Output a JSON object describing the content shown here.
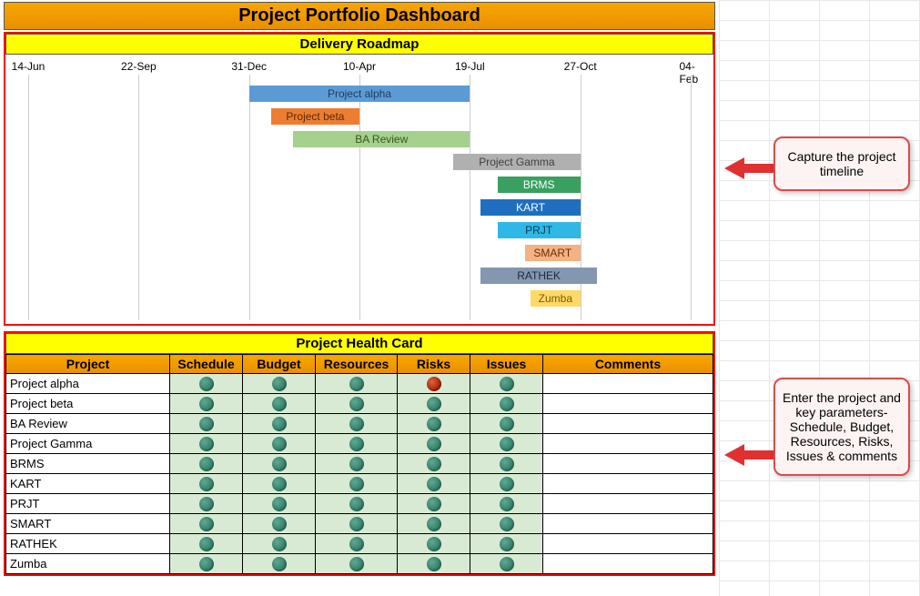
{
  "title": "Project Portfolio Dashboard",
  "roadmap_title": "Delivery Roadmap",
  "health_title": "Project Health Card",
  "dates": [
    "14-Jun",
    "22-Sep",
    "31-Dec",
    "10-Apr",
    "19-Jul",
    "27-Oct",
    "04-Feb"
  ],
  "bars": [
    {
      "label": "Project alpha",
      "color": "#5b9bd5",
      "fg": "#1f3a5f"
    },
    {
      "label": "Project beta",
      "color": "#ed7d31",
      "fg": "#5a2a00"
    },
    {
      "label": "BA Review",
      "color": "#a5d08e",
      "fg": "#385723"
    },
    {
      "label": "Project Gamma",
      "color": "#b0b0b0",
      "fg": "#404040"
    },
    {
      "label": "BRMS",
      "color": "#3aa060",
      "fg": "#fff"
    },
    {
      "label": "KART",
      "color": "#1f6fc0",
      "fg": "#fff"
    },
    {
      "label": "PRJT",
      "color": "#2fb8e5",
      "fg": "#0a3c50"
    },
    {
      "label": "SMART",
      "color": "#f4b183",
      "fg": "#6a3000"
    },
    {
      "label": "RATHEK",
      "color": "#8497b0",
      "fg": "#1e2a3a"
    },
    {
      "label": "Zumba",
      "color": "#ffd966",
      "fg": "#7a5a00"
    }
  ],
  "health_columns": [
    "Project",
    "Schedule",
    "Budget",
    "Resources",
    "Risks",
    "Issues",
    "Comments"
  ],
  "health_rows": [
    {
      "project": "Project alpha",
      "status": [
        "g",
        "g",
        "g",
        "r",
        "g"
      ],
      "comments": ""
    },
    {
      "project": "Project beta",
      "status": [
        "g",
        "g",
        "g",
        "g",
        "g"
      ],
      "comments": ""
    },
    {
      "project": "BA Review",
      "status": [
        "g",
        "g",
        "g",
        "g",
        "g"
      ],
      "comments": ""
    },
    {
      "project": "Project Gamma",
      "status": [
        "g",
        "g",
        "g",
        "g",
        "g"
      ],
      "comments": ""
    },
    {
      "project": "BRMS",
      "status": [
        "g",
        "g",
        "g",
        "g",
        "g"
      ],
      "comments": ""
    },
    {
      "project": "KART",
      "status": [
        "g",
        "g",
        "g",
        "g",
        "g"
      ],
      "comments": ""
    },
    {
      "project": "PRJT",
      "status": [
        "g",
        "g",
        "g",
        "g",
        "g"
      ],
      "comments": ""
    },
    {
      "project": "SMART",
      "status": [
        "g",
        "g",
        "g",
        "g",
        "g"
      ],
      "comments": ""
    },
    {
      "project": "RATHEK",
      "status": [
        "g",
        "g",
        "g",
        "g",
        "g"
      ],
      "comments": ""
    },
    {
      "project": "Zumba",
      "status": [
        "g",
        "g",
        "g",
        "g",
        "g"
      ],
      "comments": ""
    }
  ],
  "callout1": "Capture the project timeline",
  "callout2": "Enter the project and key parameters- Schedule, Budget, Resources, Risks, Issues & comments",
  "chart_data": {
    "type": "bar",
    "orientation": "horizontal-gantt",
    "title": "Delivery Roadmap",
    "x_ticks": [
      "14-Jun",
      "22-Sep",
      "31-Dec",
      "10-Apr",
      "19-Jul",
      "27-Oct",
      "04-Feb"
    ],
    "xlabel": "",
    "ylabel": "",
    "series": [
      {
        "name": "Project alpha",
        "start": "31-Dec",
        "end": "19-Jul"
      },
      {
        "name": "Project beta",
        "start": "20-Jan",
        "end": "20-Mar"
      },
      {
        "name": "BA Review",
        "start": "15-Feb",
        "end": "19-Jul"
      },
      {
        "name": "Project Gamma",
        "start": "05-Jul",
        "end": "27-Oct"
      },
      {
        "name": "BRMS",
        "start": "10-Aug",
        "end": "27-Oct"
      },
      {
        "name": "KART",
        "start": "05-Aug",
        "end": "27-Oct"
      },
      {
        "name": "PRJT",
        "start": "10-Aug",
        "end": "27-Oct"
      },
      {
        "name": "SMART",
        "start": "02-Sep",
        "end": "27-Oct"
      },
      {
        "name": "RATHEK",
        "start": "05-Aug",
        "end": "10-Nov"
      },
      {
        "name": "Zumba",
        "start": "10-Sep",
        "end": "27-Oct"
      }
    ]
  }
}
